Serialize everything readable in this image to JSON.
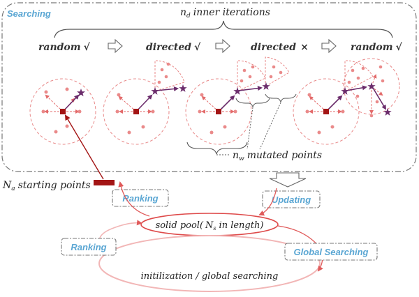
{
  "header": {
    "searching_label": "Searching",
    "inner_iter_var": "n",
    "inner_iter_sub": "d",
    "inner_iter_text": "inner iterations"
  },
  "steps": [
    {
      "word": "random",
      "mark": "√"
    },
    {
      "word": "directed",
      "mark": "√"
    },
    {
      "word": "directed",
      "mark": "×"
    },
    {
      "word": "random",
      "mark": "√"
    }
  ],
  "mutated": {
    "var": "n",
    "sub": "w",
    "text": "mutated points"
  },
  "starting": {
    "var": "N",
    "sub": "a",
    "text": "starting points"
  },
  "boxes": {
    "ranking_top": "Ranking",
    "updating": "Updating",
    "ranking_left": "Ranking",
    "global_searching": "Global Searching"
  },
  "pool": {
    "prefix": "solid pool(",
    "var": "N",
    "sub": "s",
    "suffix": "in length)"
  },
  "init_text": "initilization / global searching",
  "colors": {
    "blue_label": "#5aa6d3",
    "dark_red": "#a31515",
    "star_purple": "#6b2c6b",
    "dot_pink": "#ea8a8a",
    "dashed_circle": "#e88888",
    "pool_red": "#de4a4a"
  }
}
